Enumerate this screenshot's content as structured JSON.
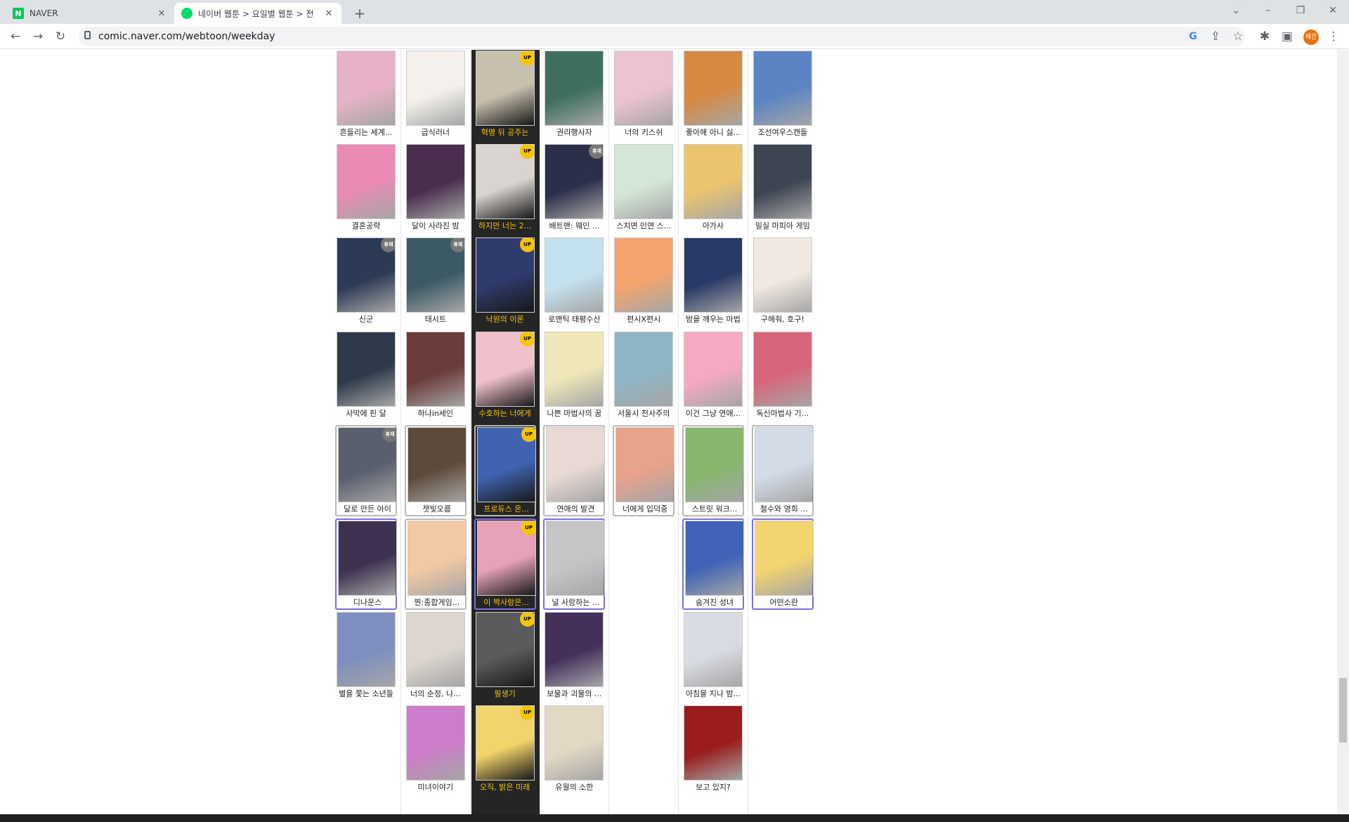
{
  "tabs": [
    {
      "title": "NAVER",
      "icon": "naver-n-icon",
      "active": false
    },
    {
      "title": "네이버 웹툰 > 요일별 웹툰 > 전",
      "icon": "webtoon-icon",
      "active": true
    }
  ],
  "address": "comic.naver.com/webtoon/weekday",
  "profile_initials": "혜은",
  "colors": {
    "today_bg": "#252525",
    "today_text": "#f7c500",
    "up_badge": "#f7c500",
    "rest_badge": "#777777",
    "purple_border": "#7a6fe0"
  },
  "columns": [
    {
      "items": [
        {
          "title": "흔들리는 세계...",
          "color": "#e7b2c7"
        },
        {
          "title": "결혼공략",
          "color": "#e98bb4"
        },
        {
          "title": "신군",
          "color": "#2d3a55",
          "badge": "휴재"
        },
        {
          "title": "사막에 핀 달",
          "color": "#2e3a4a"
        },
        {
          "title": "달로 만든 아이",
          "color": "#5a5f6e",
          "badge": "휴재",
          "frame": "box"
        },
        {
          "title": "디나운스",
          "color": "#3d3050",
          "frame": "purple"
        },
        {
          "title": "별을 쫓는 소년들",
          "color": "#7d8fbf"
        }
      ]
    },
    {
      "items": [
        {
          "title": "급식러너",
          "color": "#f4f1ec"
        },
        {
          "title": "달이 사라진 밤",
          "color": "#4a2e4e"
        },
        {
          "title": "태시트",
          "color": "#3b5a66",
          "badge": "휴재"
        },
        {
          "title": "하나in세인",
          "color": "#6a3c3a"
        },
        {
          "title": "잿빛오름",
          "color": "#5e4a3a",
          "frame": "box"
        },
        {
          "title": "찐:종합게임...",
          "color": "#f3c9a3",
          "frame": "box"
        },
        {
          "title": "너의 순정, 나...",
          "color": "#dcd6cf"
        },
        {
          "title": "미녀이야기",
          "color": "#cd7cc9"
        }
      ]
    },
    {
      "today": true,
      "items": [
        {
          "title": "혁명 뒤 공주는",
          "color": "#c8bfae",
          "badge": "UP"
        },
        {
          "title": "하지만 너는 2...",
          "color": "#d9d4cf",
          "badge": "UP"
        },
        {
          "title": "낙원의 이론",
          "color": "#2f3b6b",
          "badge": "UP"
        },
        {
          "title": "수호하는 너에게",
          "color": "#f0c0cb",
          "badge": "UP"
        },
        {
          "title": "프로듀스 온...",
          "color": "#3f63b0",
          "badge": "UP",
          "frame": "box"
        },
        {
          "title": "이 짝사랑은...",
          "color": "#e6a3b7",
          "badge": "UP",
          "frame": "purple"
        },
        {
          "title": "필생기",
          "color": "#5b5b5b",
          "badge": "UP"
        },
        {
          "title": "오직, 밝은 미래",
          "color": "#f2d46a",
          "badge": "UP"
        }
      ]
    },
    {
      "items": [
        {
          "title": "권리행사자",
          "color": "#3f6f61"
        },
        {
          "title": "배트맨: 웨인 ...",
          "color": "#2c2f4a",
          "badge": "휴재"
        },
        {
          "title": "로맨틱 태평수산",
          "color": "#c4e1ef"
        },
        {
          "title": "나쁜 마법사의 꿈",
          "color": "#efe7b8"
        },
        {
          "title": "연애의 발견",
          "color": "#e8d9d4",
          "frame": "box"
        },
        {
          "title": "널 사랑하는 ...",
          "color": "#c7c4c7",
          "frame": "purple"
        },
        {
          "title": "보물과 괴물의 ...",
          "color": "#45305c"
        },
        {
          "title": "유월의 소한",
          "color": "#e3d8c4"
        }
      ]
    },
    {
      "items": [
        {
          "title": "너의 키스쉬",
          "color": "#ecc3cf"
        },
        {
          "title": "스치면 인연 스...",
          "color": "#d4e6d7"
        },
        {
          "title": "편시X편시",
          "color": "#f4a56e"
        },
        {
          "title": "서울시 천사주의",
          "color": "#8fb6c6"
        },
        {
          "title": "너에게 입덕중",
          "color": "#e9a28b",
          "frame": "box"
        }
      ]
    },
    {
      "items": [
        {
          "title": "좋아해 아니 싫...",
          "color": "#d78944"
        },
        {
          "title": "아가사",
          "color": "#ebc46f"
        },
        {
          "title": "밤을 깨우는 마법",
          "color": "#2a3a66"
        },
        {
          "title": "이건 그냥 연애...",
          "color": "#f5a9c3"
        },
        {
          "title": "스트릿 워크...",
          "color": "#87b66e",
          "frame": "box"
        },
        {
          "title": "숨겨진 성녀",
          "color": "#4063b8",
          "frame": "purple"
        },
        {
          "title": "아침을 지나 밤...",
          "color": "#d9dbe2"
        },
        {
          "title": "보고 있지?",
          "color": "#9b1c1c"
        }
      ]
    },
    {
      "items": [
        {
          "title": "조선여우스캔들",
          "color": "#5b84c4"
        },
        {
          "title": "밀실 마피아 게임",
          "color": "#3e4552"
        },
        {
          "title": "구해줘, 호구!",
          "color": "#f0e8e1"
        },
        {
          "title": "독신마법사 기...",
          "color": "#d9657a"
        },
        {
          "title": "철수와 영희 ...",
          "color": "#d3dbe7",
          "frame": "box"
        },
        {
          "title": "어떤소란",
          "color": "#f3d46e",
          "frame": "purple"
        }
      ]
    }
  ]
}
